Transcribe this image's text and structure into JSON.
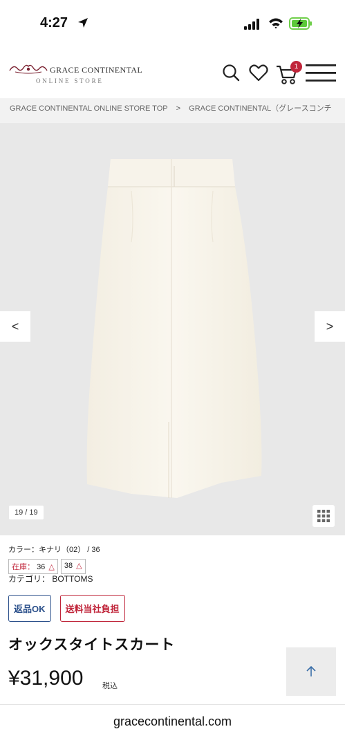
{
  "status_bar": {
    "time": "4:27"
  },
  "header": {
    "logo_title": "GRACE CONTINENTAL",
    "logo_subtitle": "ONLINE STORE",
    "cart_count": "1"
  },
  "breadcrumb": {
    "items": [
      "GRACE CONTINENTAL ONLINE STORE TOP",
      "GRACE CONTINENTAL（グレースコンチ"
    ],
    "separator": ">"
  },
  "gallery": {
    "prev_label": "<",
    "next_label": ">",
    "counter": "19 / 19"
  },
  "product": {
    "color_line": "カラー：キナリ（02） / 36",
    "stock_label": "在庫：",
    "stock": [
      {
        "size": "36",
        "mark": "△"
      },
      {
        "size": "38",
        "mark": "△"
      }
    ],
    "category_line": "カテゴリ： BOTTOMS",
    "tag_return": "返品OK",
    "tag_shipping": "送料当社負担",
    "name": "オックスタイトスカート",
    "price": "¥31,900",
    "tax_label": "税込"
  },
  "url_bar": {
    "url": "gracecontinental.com"
  },
  "colors": {
    "accent_red": "#c0253a",
    "accent_blue": "#2a4f8a",
    "gallery_bg": "#e8e8e8",
    "skirt": "#f7f3ea"
  }
}
